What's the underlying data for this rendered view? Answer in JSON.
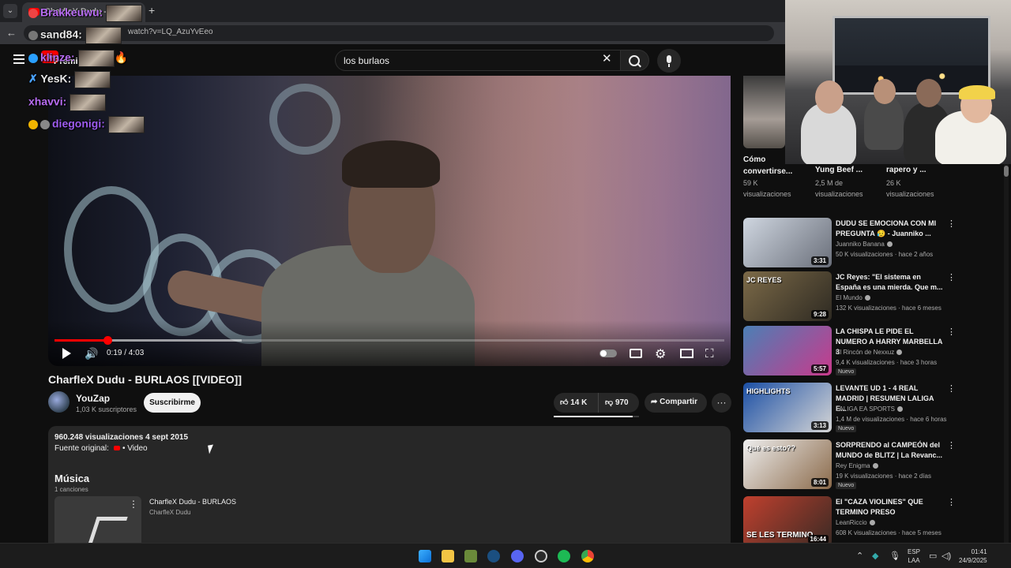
{
  "browser": {
    "tab_title": "CharfleX Dudu - BUR",
    "url": "watch?v=LQ_AzuYvEeo"
  },
  "youtube": {
    "logo_label": "Premium",
    "search_value": "los burlaos"
  },
  "chat": [
    {
      "user": "Brakkeuwu:",
      "color": "#b76cf2"
    },
    {
      "user": "sand84:",
      "color": "#e9e9e9"
    },
    {
      "user": "klinze:",
      "color": "#b76cf2"
    },
    {
      "user": "YesK:",
      "color": "#e9e9e9"
    },
    {
      "user": "xhavvi:",
      "color": "#b76cf2"
    },
    {
      "user": "diegonigi:",
      "color": "#9d5cf0"
    }
  ],
  "player": {
    "time": "0:19 / 4:03",
    "played_fraction": 0.079,
    "buffered_fraction": 0.28
  },
  "video": {
    "title": "CharfleX Dudu - BURLAOS [[VIDEO]]",
    "channel": "YouZap",
    "subscribers": "1,03 K suscriptores",
    "subscribe_label": "Suscribirme",
    "likes": "14 K",
    "dislikes": "970",
    "share_label": "Compartir",
    "more_label": "···"
  },
  "description": {
    "views_date": "960.248 visualizaciones  4 sept 2015",
    "source_label": "Fuente original:",
    "source_link": "• Video",
    "music_heading": "Música",
    "music_count": "1 canciones",
    "song_title": "CharfleX Dudu - BURLAOS",
    "song_artist": "CharfleX Dudu"
  },
  "shorts": [
    {
      "title": "Cómo convertirse...",
      "views": "59 K visualizaciones"
    },
    {
      "title": "Yung Beef ...",
      "views": "2,5 M de visualizaciones"
    },
    {
      "title": "rapero y ...",
      "views": "26 K visualizaciones"
    }
  ],
  "related": [
    {
      "title": "DUDU SE EMOCIONA CON MI PREGUNTA 😥 - Juanniko ...",
      "channel": "Juanniko Banana",
      "stats": "50 K visualizaciones · hace 2 años",
      "duration": "3:31",
      "is_new": "",
      "thumb": [
        "#cfd6e0",
        "#6a6f7a"
      ]
    },
    {
      "title": "JC Reyes: \"El sistema en España es una mierda. Que m...",
      "channel": "El Mundo",
      "stats": "132 K visualizaciones · hace 6 meses",
      "duration": "9:28",
      "is_new": "",
      "thumb": [
        "#7c6a48",
        "#2e2a22"
      ]
    },
    {
      "title": "LA CHISPA LE PIDE EL NUMERO A HARRY MARBELLA 3",
      "channel": "El Rincón de Nexxuz",
      "stats": "9,4 K visualizaciones · hace 3 horas",
      "duration": "5:57",
      "is_new": "Nuevo",
      "thumb": [
        "#4b7fb5",
        "#c93a8c"
      ]
    },
    {
      "title": "LEVANTE UD 1 - 4 REAL MADRID | RESUMEN LALIGA E...",
      "channel": "LALIGA EA SPORTS",
      "stats": "1,4 M de visualizaciones · hace 6 horas",
      "duration": "3:13",
      "is_new": "Nuevo",
      "thumb": [
        "#1b4fa5",
        "#d6d6d6"
      ]
    },
    {
      "title": "SORPRENDO al CAMPEÓN del MUNDO de BLITZ | La Revanc...",
      "channel": "Rey Enigma",
      "stats": "19 K visualizaciones · hace 2 días",
      "duration": "8:01",
      "is_new": "Nuevo",
      "thumb": [
        "#eeeeee",
        "#8b6a4a"
      ]
    },
    {
      "title": "El \"CAZA VIOLINES\" QUE TERMINO PRESO",
      "channel": "LeanRiccio",
      "stats": "608 K visualizaciones · hace 5 meses",
      "duration": "16:44",
      "is_new": "",
      "thumb": [
        "#c0402e",
        "#3a2a24"
      ]
    }
  ],
  "thumb_overlays": {
    "jc_reyes": "JC REYES",
    "highlights": "HIGHLIGHTS",
    "chess_caption": "Qué es esto??",
    "caza": "SE LES TERMINO"
  },
  "taskbar": {
    "lang_top": "ESP",
    "lang_bottom": "LAA",
    "time": "01:41",
    "date": "24/9/2025",
    "icons": [
      "windows-start",
      "file-explorer",
      "steam-like",
      "steam",
      "discord",
      "obs",
      "spotify",
      "chrome"
    ]
  },
  "colors": {
    "accent_red": "#ff0000",
    "bg": "#0f0f0f",
    "surface": "#272727"
  }
}
